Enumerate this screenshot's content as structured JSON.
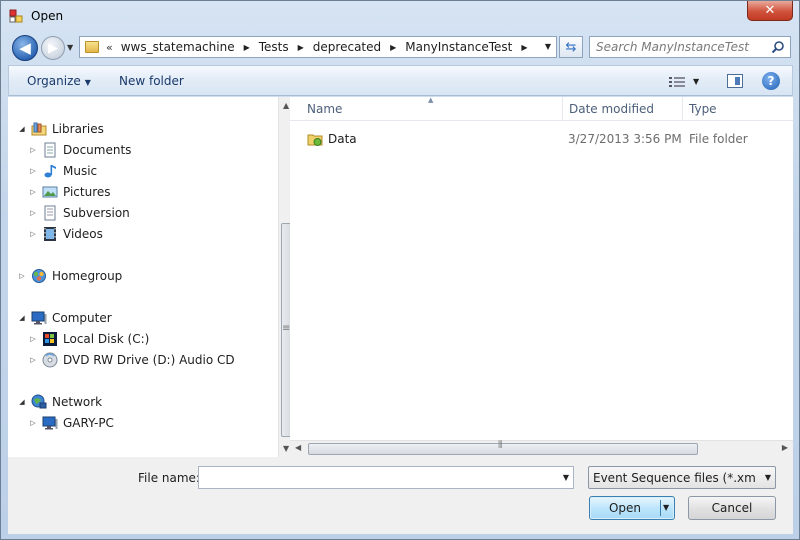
{
  "window": {
    "title": "Open",
    "close_glyph": "✕"
  },
  "navigation": {
    "back_glyph": "◀",
    "forward_glyph": "▶",
    "address": {
      "overflow": "«",
      "crumbs": [
        "wws_statemachine",
        "Tests",
        "deprecated",
        "ManyInstanceTest"
      ]
    },
    "refresh_glyph": "⇆",
    "search": {
      "placeholder": "Search ManyInstanceTest"
    }
  },
  "toolbar": {
    "organize_label": "Organize",
    "new_folder_label": "New folder",
    "help_label": "?"
  },
  "nav_tree": {
    "libraries": {
      "label": "Libraries",
      "children": [
        "Documents",
        "Music",
        "Pictures",
        "Subversion",
        "Videos"
      ]
    },
    "homegroup": {
      "label": "Homegroup"
    },
    "computer": {
      "label": "Computer",
      "children": [
        "Local Disk (C:)",
        "DVD RW Drive (D:) Audio CD"
      ]
    },
    "network": {
      "label": "Network",
      "children": [
        "GARY-PC"
      ]
    }
  },
  "file_list": {
    "columns": {
      "name": "Name",
      "date_modified": "Date modified",
      "type": "Type"
    },
    "rows": [
      {
        "name": "Data",
        "date_modified": "3/27/2013 3:56 PM",
        "type": "File folder"
      }
    ]
  },
  "footer": {
    "file_name_label": "File name:",
    "file_name_value": "",
    "file_type_filter": "Event Sequence files (*.xml;*.es",
    "open_label": "Open",
    "cancel_label": "Cancel"
  },
  "icons": {
    "folder": "folder-icon",
    "libraries": "libraries-icon",
    "homegroup": "homegroup-icon",
    "computer": "computer-icon",
    "network": "network-icon",
    "disk": "local-disk-icon",
    "dvd": "dvd-drive-icon"
  },
  "colors": {
    "accent": "#2d66b4",
    "link": "#1a3a6b",
    "header_text": "#4c607a"
  }
}
